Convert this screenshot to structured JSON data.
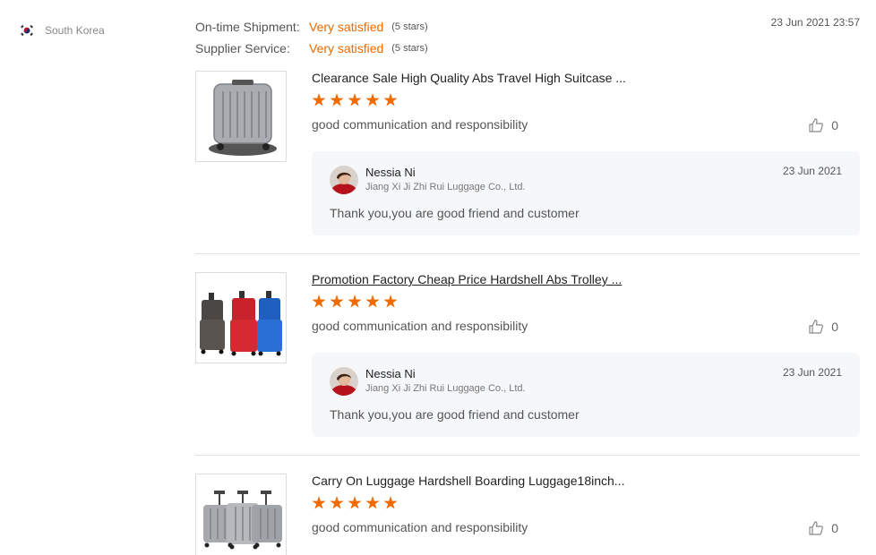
{
  "reviewer": {
    "country": "South Korea"
  },
  "supplier_ratings": [
    {
      "label": "On-time Shipment:",
      "value": "Very satisfied",
      "stars_text": "(5 stars)"
    },
    {
      "label": "Supplier Service:",
      "value": "Very satisfied",
      "stars_text": "(5 stars)"
    }
  ],
  "review_date": "23 Jun 2021 23:57",
  "reviews": [
    {
      "product_title": "Clearance Sale High Quality Abs Travel High Suitcase ...",
      "rating": 5,
      "comment": "good communication and responsibility",
      "likes": "0",
      "reply": {
        "author": "Nessia Ni",
        "company": "Jiang Xi Ji Zhi Rui Luggage Co., Ltd.",
        "date": "23 Jun 2021",
        "text": "Thank you,you are good friend and customer"
      }
    },
    {
      "product_title": "Promotion Factory Cheap Price Hardshell Abs Trolley ...",
      "rating": 5,
      "comment": "good communication and responsibility",
      "likes": "0",
      "reply": {
        "author": "Nessia Ni",
        "company": "Jiang Xi Ji Zhi Rui Luggage Co., Ltd.",
        "date": "23 Jun 2021",
        "text": "Thank you,you are good friend and customer"
      }
    },
    {
      "product_title": "Carry On Luggage Hardshell Boarding Luggage18inch...",
      "rating": 5,
      "comment": "good communication and responsibility",
      "likes": "0"
    }
  ],
  "colors": {
    "accent": "#f06a00",
    "reply_bg": "#f6f7f9",
    "divider": "#e3e3e3"
  },
  "icons": {
    "flag": "south-korea-flag-icon",
    "like": "thumbs-up-icon"
  }
}
